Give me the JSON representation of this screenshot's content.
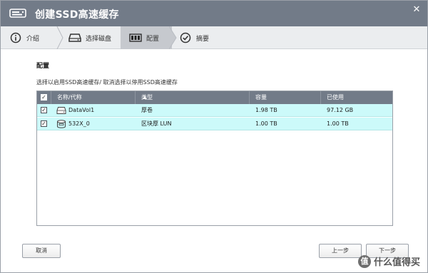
{
  "title_bar": {
    "title": "创建SSD高速缓存",
    "close_glyph": "✕"
  },
  "steps": [
    {
      "label": "介绍",
      "icon": "info-circle-icon"
    },
    {
      "label": "选择磁盘",
      "icon": "drive-icon"
    },
    {
      "label": "配置",
      "icon": "config-bars-icon"
    },
    {
      "label": "摘要",
      "icon": "check-circle-icon"
    }
  ],
  "active_step": 2,
  "section": {
    "title": "配置",
    "instruction": "选择以启用SSD高速缓存/ 取消选择以停用SSD高速缓存"
  },
  "table": {
    "headers": {
      "name": "名称/代称",
      "type": "类型",
      "capacity": "容量",
      "used": "已使用"
    },
    "header_checked": true,
    "rows": [
      {
        "checked": true,
        "icon": "volume-icon",
        "name": "DataVol1",
        "type": "厚卷",
        "capacity": "1.98 TB",
        "used": "97.12 GB"
      },
      {
        "checked": true,
        "icon": "lun-icon",
        "name": "532X_0",
        "type": "区块厚 LUN",
        "capacity": "1.00 TB",
        "used": "1.00 TB"
      }
    ]
  },
  "buttons": {
    "cancel": "取消",
    "prev": "上一步",
    "next": "下一步"
  },
  "watermark": {
    "glyph": "值",
    "text": "什么值得买"
  },
  "colors": {
    "titlebar": "#727b88",
    "row_selected": "#ccfafa",
    "active_step": "#c6c9ce"
  }
}
